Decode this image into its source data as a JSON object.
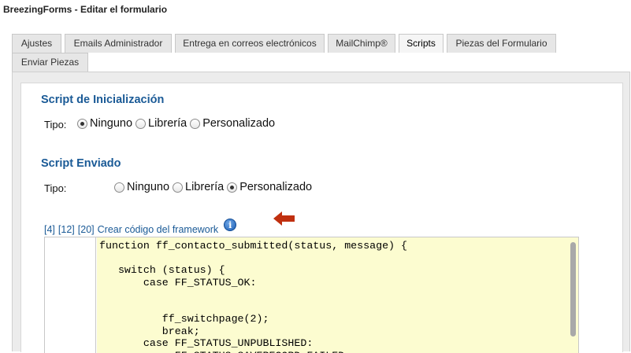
{
  "window": {
    "title": "BreezingForms - Editar el formulario"
  },
  "tabs": [
    {
      "label": "Ajustes",
      "active": false
    },
    {
      "label": "Emails Administrador",
      "active": false
    },
    {
      "label": "Entrega en correos electrónicos",
      "active": false
    },
    {
      "label": "MailChimp®",
      "active": false
    },
    {
      "label": "Scripts",
      "active": true
    },
    {
      "label": "Piezas del Formulario",
      "active": false
    },
    {
      "label": "Enviar Piezas",
      "active": false
    }
  ],
  "init_script": {
    "title": "Script de Inicialización",
    "tipo_label": "Tipo:",
    "options": [
      {
        "label": "Ninguno",
        "checked": true
      },
      {
        "label": "Librería",
        "checked": false
      },
      {
        "label": "Personalizado",
        "checked": false
      }
    ]
  },
  "submitted_script": {
    "title": "Script Enviado",
    "tipo_label": "Tipo:",
    "options": [
      {
        "label": "Ninguno",
        "checked": false
      },
      {
        "label": "Librería",
        "checked": false
      },
      {
        "label": "Personalizado",
        "checked": true
      }
    ],
    "links": {
      "link_4": "[4]",
      "link_12": "[12]",
      "link_20": "[20]",
      "framework": "Crear código del framework",
      "info_icon": "info-icon"
    },
    "code_lines": [
      "function ff_contacto_submitted(status, message) {",
      "",
      "   switch (status) {",
      "       case FF_STATUS_OK:",
      "",
      "",
      "          ff_switchpage(2);",
      "          break;",
      "       case FF_STATUS_UNPUBLISHED:",
      "       case FF_STATUS_SAVERECORD_FAILED:"
    ]
  },
  "colors": {
    "section_title": "#1a5a96",
    "code_background": "#fcfcd0",
    "annotation_arrow": "#c0300f"
  }
}
